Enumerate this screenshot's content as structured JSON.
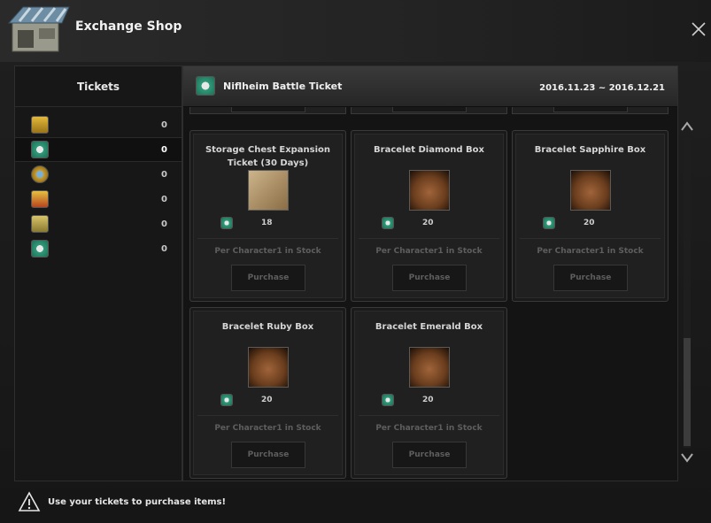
{
  "window": {
    "title": "Exchange Shop"
  },
  "left_panel": {
    "header": "Tickets",
    "tickets": [
      {
        "icon": "yellow-ticket-icon",
        "count": "0"
      },
      {
        "icon": "niflheim-ticket-icon",
        "count": "0"
      },
      {
        "icon": "gold-coin-ticket-icon",
        "count": "0"
      },
      {
        "icon": "yellow-red-ticket-icon",
        "count": "0"
      },
      {
        "icon": "today-ticket-icon",
        "count": "0"
      },
      {
        "icon": "green-ticket-icon",
        "count": "0"
      }
    ]
  },
  "right_panel": {
    "ticket_name": "Niflheim Battle Ticket",
    "date_range": "2016.11.23 ~ 2016.12.21",
    "items": [
      {
        "name": "Storage Chest Expansion Ticket (30 Days)",
        "cost": "18",
        "stock": "Per Character1 in Stock",
        "button": "Purchase",
        "image": "scroll-icon"
      },
      {
        "name": "Bracelet Diamond Box",
        "cost": "20",
        "stock": "Per Character1 in Stock",
        "button": "Purchase",
        "image": "chest-diamond-icon"
      },
      {
        "name": "Bracelet Sapphire Box",
        "cost": "20",
        "stock": "Per Character1 in Stock",
        "button": "Purchase",
        "image": "chest-sapphire-icon"
      },
      {
        "name": "Bracelet Ruby Box",
        "cost": "20",
        "stock": "Per Character1 in Stock",
        "button": "Purchase",
        "image": "chest-ruby-icon"
      },
      {
        "name": "Bracelet Emerald Box",
        "cost": "20",
        "stock": "Per Character1 in Stock",
        "button": "Purchase",
        "image": "chest-emerald-icon"
      }
    ]
  },
  "footer": {
    "notice": "Use your tickets to purchase items!"
  },
  "colors": {
    "background": "#1c1c1c",
    "text": "#d8d8d8",
    "disabled_text": "#5e5e5e",
    "ticket_green": "#2f9b7a"
  }
}
